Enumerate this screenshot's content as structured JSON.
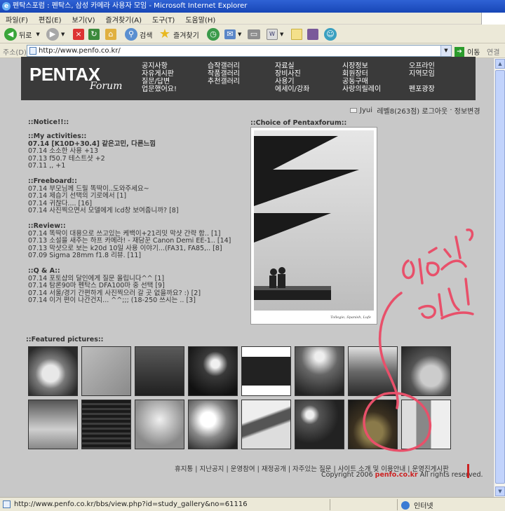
{
  "window": {
    "title": "펜탁스포럼 : 펜탁스, 삼성 카메라 사용자 모임 - Microsoft Internet Explorer"
  },
  "menubar": [
    "파일(F)",
    "편집(E)",
    "보기(V)",
    "즐겨찾기(A)",
    "도구(T)",
    "도움말(H)"
  ],
  "toolbar": {
    "back": "뒤로",
    "search": "검색",
    "favorites": "즐겨찾기"
  },
  "address": {
    "label": "주소(D)",
    "url": "http://www.penfo.co.kr/",
    "go": "이동",
    "links": "연결"
  },
  "site": {
    "logo": "PENTAX",
    "logo_sub": "Forum",
    "nav_columns": [
      [
        "공지사항",
        "자유게시판",
        "질문/답변",
        "업문했어요!"
      ],
      [
        "습작갤러리",
        "작품갤러리",
        "추천갤러리"
      ],
      [
        "자료실",
        "장비사진",
        "사용기",
        "에세이/강좌"
      ],
      [
        "시장정보",
        "회원장터",
        "공동구매",
        "사랑의릴레이"
      ],
      [
        "오프라인",
        "지역모임",
        "",
        "펜포광장"
      ]
    ],
    "user": {
      "name": "Jyui",
      "level": "레벨8(263점)",
      "logout": "로그아웃",
      "edit": "정보변경"
    },
    "notice_title": "::Notice!!::",
    "sections": [
      {
        "title": "::My activities::",
        "items": [
          {
            "text": "07.14 [K10D+30.4] 같은고민, 다른느낌",
            "bold": true
          },
          {
            "text": "07.14 소소한 사용 +13",
            "bold": false
          },
          {
            "text": "07.13 f50.7 테스트샷 +2",
            "bold": false
          },
          {
            "text": "07.11 ,, +1",
            "bold": false
          }
        ]
      },
      {
        "title": "::Freeboard::",
        "items": [
          {
            "text": "07.14 부모님께 드릴 똑딱이..도와주세요~",
            "bold": false
          },
          {
            "text": "07.14 제습기 선택의 기로에서 [1]",
            "bold": false
          },
          {
            "text": "07.14 귀찮다.... [16]",
            "bold": false
          },
          {
            "text": "07.14 사진찍으면서 모델에게 lcd창 보여줍니까? [8]",
            "bold": false
          }
        ]
      },
      {
        "title": "::Review::",
        "items": [
          {
            "text": "07.14 똑딱이 대용으로 쓰고있는 케백이+21리밋 막샷 간략 함.. [1]",
            "bold": false
          },
          {
            "text": "07.13 소설을 새주는 하프 카메라! - 재담꾼 Canon Demi EE-1.. [14]",
            "bold": false
          },
          {
            "text": "07.13 막샷으로 보는 k20d 10일 사용 이야기...(FA31, FA85,.. [8]",
            "bold": false
          },
          {
            "text": "07.09 Sigma 28mm f1.8 리뷰. [11]",
            "bold": false
          }
        ]
      },
      {
        "title": "::Q & A::",
        "items": [
          {
            "text": "07.14 포토샵의 달인에게 질문 올립니다^^ [1]",
            "bold": false
          },
          {
            "text": "07.14 탐론90마 펜탁스 DFA100마 중 선택 [9]",
            "bold": false
          },
          {
            "text": "07.14 서울/경기 간편하게 사진찍으러 갈 곳 없을까요? :) [2]",
            "bold": false
          },
          {
            "text": "07.14 이거 편이 나간건지... ^^;;; (18-250 쓰시는 .. [3]",
            "bold": false
          }
        ]
      }
    ],
    "choice_title": "::Choice of Pentaxforum::",
    "choice_signature": "Tollegio, Spanish, Lufe",
    "featured_title": "::Featured pictures::",
    "footer_links": "휴지통 | 지난공지 | 운영참여 | 재정공개 | 자주있는 질문 | 사이트 소개 및 이용안내 | 운영진게시판",
    "footer_copy_prefix": "Copyright 2006 ",
    "footer_copy_brand": "penfo.co.kr",
    "footer_copy_suffix": " All rights reserved."
  },
  "statusbar": {
    "url": "http://www.penfo.co.kr/bbs/view.php?id=study_gallery&no=61116",
    "zone": "인터넷"
  },
  "thumbnails": [
    "sheep",
    "polaroid",
    "sailboat",
    "flower",
    "hands",
    "city-aerial",
    "sunset-sky",
    "child-face",
    "clouds",
    "stripes",
    "sky",
    "light-road",
    "flute",
    "bokeh",
    "card-game",
    "street"
  ]
}
